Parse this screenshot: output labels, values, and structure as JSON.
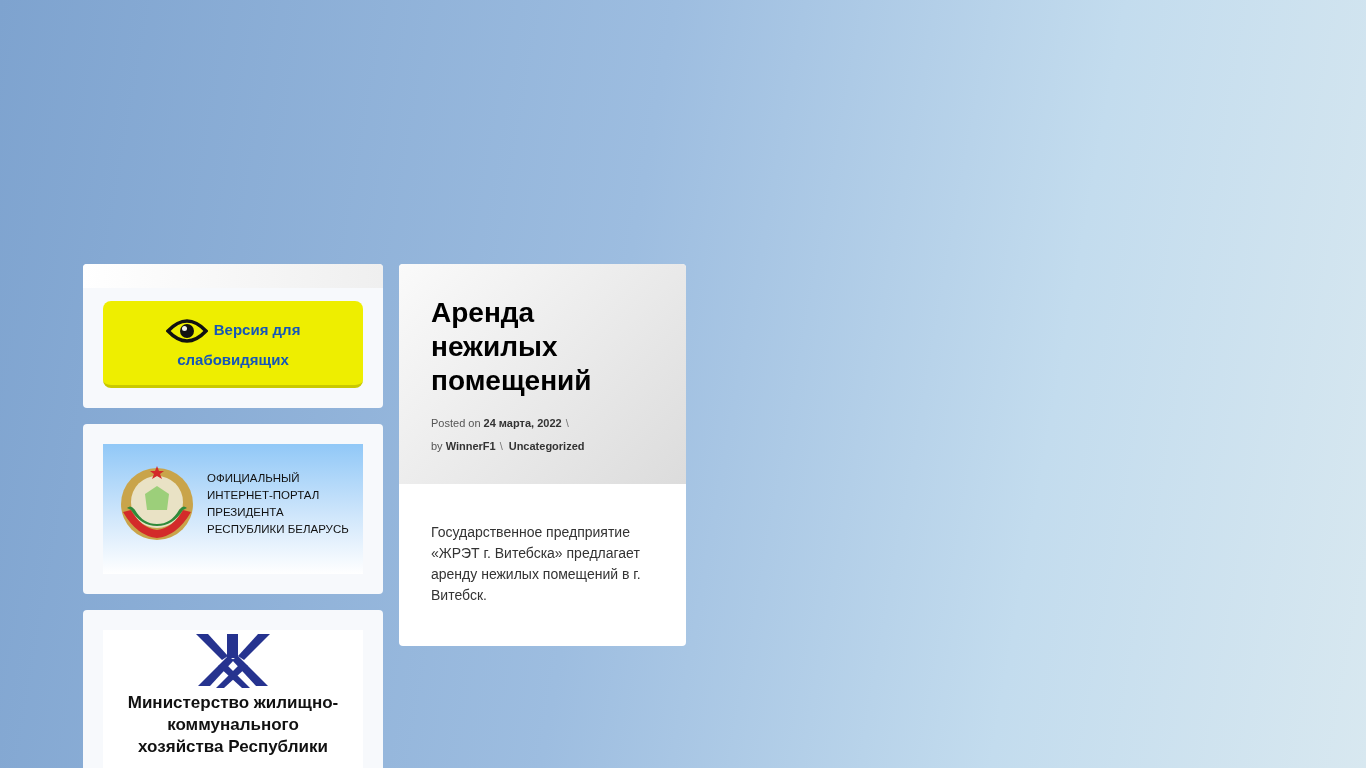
{
  "accessibility_button": {
    "label": "Версия для слабовидящих"
  },
  "banners": [
    {
      "kind": "president",
      "lines": [
        "ОФИЦИАЛЬНЫЙ",
        "ИНТЕРНЕТ-ПОРТАЛ",
        "ПРЕЗИДЕНТА",
        "РЕСПУБЛИКИ БЕЛАРУСЬ"
      ]
    },
    {
      "kind": "ministry",
      "lines": [
        "Министерство жилищно-",
        "коммунального",
        "хозяйства Республики"
      ]
    }
  ],
  "post": {
    "title": "Аренда нежилых помещений",
    "meta_lines": [
      [
        {
          "kind": "text",
          "text": "Posted on"
        },
        {
          "kind": "link",
          "text": "24 марта, 2022"
        },
        {
          "kind": "separator",
          "text": "\\"
        }
      ],
      [
        {
          "kind": "text",
          "text": "by"
        },
        {
          "kind": "link",
          "text": "WinnerF1"
        },
        {
          "kind": "separator",
          "text": "\\"
        },
        {
          "kind": "link",
          "text": "Uncategorized"
        }
      ]
    ],
    "excerpt": "Государственное предприятие «ЖРЭТ г. Витебска» предлагает аренду нежилых помещений в г. Витебск."
  }
}
